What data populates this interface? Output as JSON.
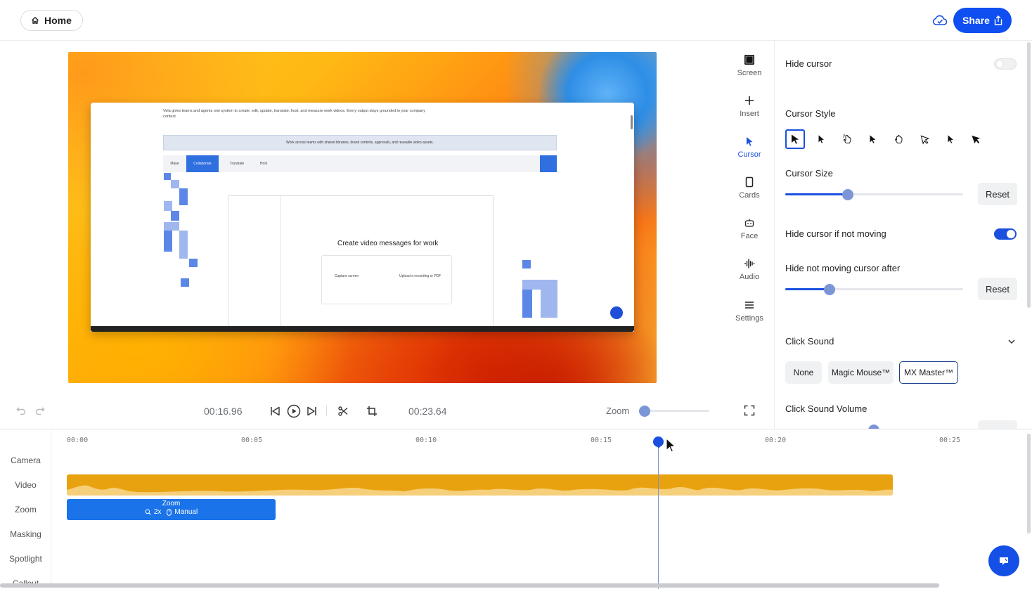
{
  "header": {
    "home_label": "Home",
    "share_label": "Share"
  },
  "preview": {
    "inner_heading": "Create video messages for work",
    "inner_intro": "Vela gives teams and agents one system to create, edit, update, translate, host, and measure work videos. Every output stays grounded in your company context.",
    "inner_banner": "Work across teams with shared libraries, brand controls, approvals, and reusable video assets.",
    "inner_tabs": [
      "Make",
      "Collaborate",
      "Translate",
      "Host"
    ],
    "inner_card_left": "Capture screen",
    "inner_card_right": "Upload a recording or PDF"
  },
  "tool_rail": [
    {
      "label": "Screen",
      "icon": "screen-icon"
    },
    {
      "label": "Insert",
      "icon": "plus-icon"
    },
    {
      "label": "Cursor",
      "icon": "cursor-icon",
      "active": true
    },
    {
      "label": "Cards",
      "icon": "cards-icon"
    },
    {
      "label": "Face",
      "icon": "face-icon"
    },
    {
      "label": "Audio",
      "icon": "audio-icon"
    },
    {
      "label": "Settings",
      "icon": "settings-icon"
    }
  ],
  "cursor_panel": {
    "hide_cursor_label": "Hide cursor",
    "hide_cursor_on": false,
    "cursor_style_label": "Cursor Style",
    "cursor_style_selected": 0,
    "cursor_size_label": "Cursor Size",
    "cursor_size_value": 0.35,
    "reset_label": "Reset",
    "hide_if_not_moving_label": "Hide cursor if not moving",
    "hide_if_not_moving_on": true,
    "hide_after_label": "Hide not moving cursor after",
    "hide_after_value": 0.25,
    "click_sound_label": "Click Sound",
    "click_sound_options": [
      "None",
      "Magic Mouse™",
      "MX Master™"
    ],
    "click_sound_selected": "MX Master™",
    "click_sound_volume_label": "Click Sound Volume"
  },
  "player": {
    "current_time": "00:16.96",
    "total_time": "00:23.64",
    "zoom_label": "Zoom",
    "zoom_value": 0.0
  },
  "timeline": {
    "tracks": [
      "Camera",
      "Video",
      "Zoom",
      "Masking",
      "Spotlight",
      "Callout"
    ],
    "ticks": [
      "00:00",
      "00:05",
      "00:10",
      "00:15",
      "00:20",
      "00:25"
    ],
    "zoom_clip": {
      "title": "Zoom",
      "level": "2x",
      "mode": "Manual"
    }
  },
  "colors": {
    "accent": "#1a4fe0",
    "share_bg": "#0f4ef0",
    "video_clip": "#e9a20f",
    "zoom_clip": "#1a73e8"
  }
}
